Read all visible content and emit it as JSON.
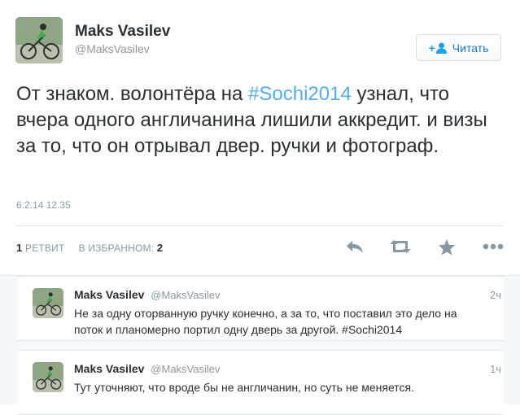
{
  "tweet": {
    "author_name": "Maks Vasilev",
    "author_handle": "@MaksVasilev",
    "follow_label": "Читать",
    "text_before": "От знаком. волонтёра на ",
    "hashtag": "#Sochi2014",
    "text_after": " узнал, что вчера одного англичанина лишили аккредит. и визы за то, что он отрывал двер. ручки и фотограф.",
    "timestamp": "6.2.14 12.35",
    "retweet_count": "1",
    "retweet_label": "РЕТВИТ",
    "favorite_label": "В ИЗБРАННОМ:",
    "favorite_count": "2"
  },
  "icons": {
    "reply": "reply-icon",
    "retweet": "retweet-icon",
    "favorite": "star-icon",
    "more": "more-icon",
    "follow": "add-user-icon"
  },
  "colors": {
    "link": "#55acee",
    "follow_text": "#1c7ac7",
    "muted": "#8899a6",
    "icon": "#8899a6"
  },
  "replies": [
    {
      "author_name": "Maks Vasilev",
      "author_handle": "@MaksVasilev",
      "time": "2ч",
      "text": "Не за одну оторванную ручку конечно, а за то, что поставил это дело на поток и планомерно портил одну дверь за другой. #Sochi2014"
    },
    {
      "author_name": "Maks Vasilev",
      "author_handle": "@MaksVasilev",
      "time": "1ч",
      "text": "Тут уточняют, что вроде бы не англичанин, но суть не меняется."
    }
  ]
}
